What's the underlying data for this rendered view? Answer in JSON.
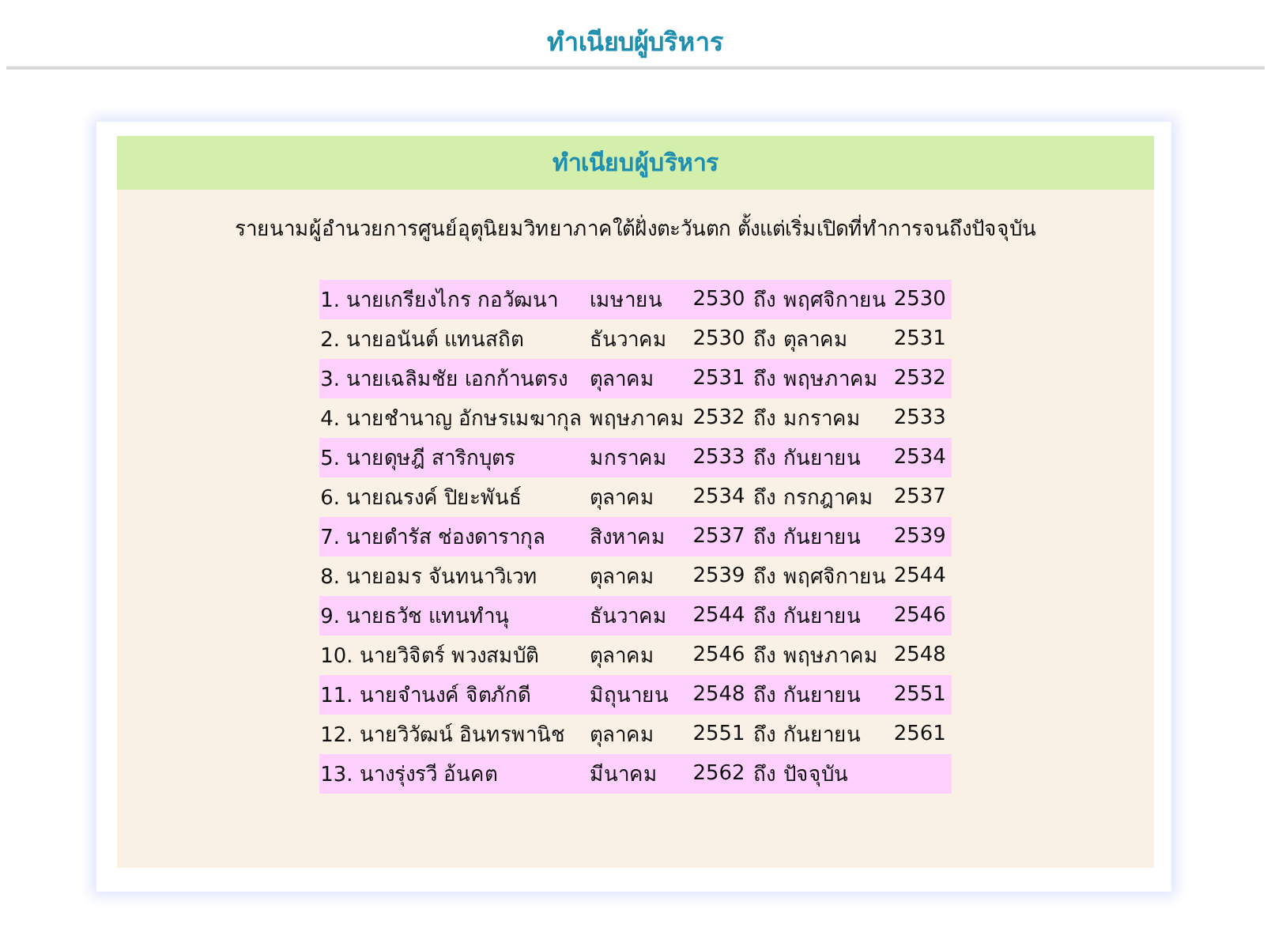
{
  "page_title": "ทำเนียบผู้บริหาร",
  "card": {
    "title": "ทำเนียบผู้บริหาร",
    "subtitle": "รายนามผู้อำนวยการศูนย์อุตุนิยมวิทยาภาคใต้ฝั่งตะวันตก ตั้งแต่เริ่มเปิดที่ทำการจนถึงปัจจุบัน",
    "rows": [
      {
        "name": "1. นายเกรียงไกร  กอวัฒนา",
        "from_month": "เมษายน",
        "from_year": "2530",
        "to": "ถึง",
        "to_month": "พฤศจิกายน",
        "to_year": "2530"
      },
      {
        "name": "2. นายอนันต์  แทนสถิต",
        "from_month": "ธันวาคม",
        "from_year": "2530",
        "to": "ถึง",
        "to_month": "ตุลาคม",
        "to_year": "2531"
      },
      {
        "name": "3. นายเฉลิมชัย  เอกก้านตรง",
        "from_month": "ตุลาคม",
        "from_year": "2531",
        "to": "ถึง",
        "to_month": "พฤษภาคม",
        "to_year": "2532"
      },
      {
        "name": "4. นายชำนาญ  อักษรเมฆากุล",
        "from_month": "พฤษภาคม",
        "from_year": "2532",
        "to": "ถึง",
        "to_month": "มกราคม",
        "to_year": "2533"
      },
      {
        "name": "5. นายดุษฎี  สาริกบุตร",
        "from_month": "มกราคม",
        "from_year": "2533",
        "to": "ถึง",
        "to_month": "กันยายน",
        "to_year": "2534"
      },
      {
        "name": "6. นายณรงค์  ปิยะพันธ์",
        "from_month": "ตุลาคม",
        "from_year": "2534",
        "to": "ถึง",
        "to_month": "กรกฎาคม",
        "to_year": "2537"
      },
      {
        "name": "7. นายดำรัส  ช่องดารากุล",
        "from_month": "สิงหาคม",
        "from_year": "2537",
        "to": "ถึง",
        "to_month": "กันยายน",
        "to_year": "2539"
      },
      {
        "name": "8. นายอมร  จันทนาวิเวท",
        "from_month": "ตุลาคม",
        "from_year": "2539",
        "to": "ถึง",
        "to_month": "พฤศจิกายน",
        "to_year": "2544"
      },
      {
        "name": "9. นายธวัช  แทนทำนุ",
        "from_month": "ธันวาคม",
        "from_year": "2544",
        "to": "ถึง",
        "to_month": "กันยายน",
        "to_year": "2546"
      },
      {
        "name": "10. นายวิจิตร์  พวงสมบัติ",
        "from_month": "ตุลาคม",
        "from_year": "2546",
        "to": "ถึง",
        "to_month": "พฤษภาคม",
        "to_year": "2548"
      },
      {
        "name": "11. นายจำนงค์  จิตภักดี",
        "from_month": "มิถุนายน",
        "from_year": "2548",
        "to": "ถึง",
        "to_month": "กันยายน",
        "to_year": "2551"
      },
      {
        "name": "12. นายวิวัฒน์  อินทรพานิช",
        "from_month": "ตุลาคม",
        "from_year": "2551",
        "to": "ถึง",
        "to_month": "กันยายน",
        "to_year": "2561"
      },
      {
        "name": "13. นางรุ่งรวี  อ้นคต",
        "from_month": "มีนาคม",
        "from_year": "2562",
        "to": "ถึง",
        "to_month": "ปัจจุบัน"
      }
    ]
  }
}
